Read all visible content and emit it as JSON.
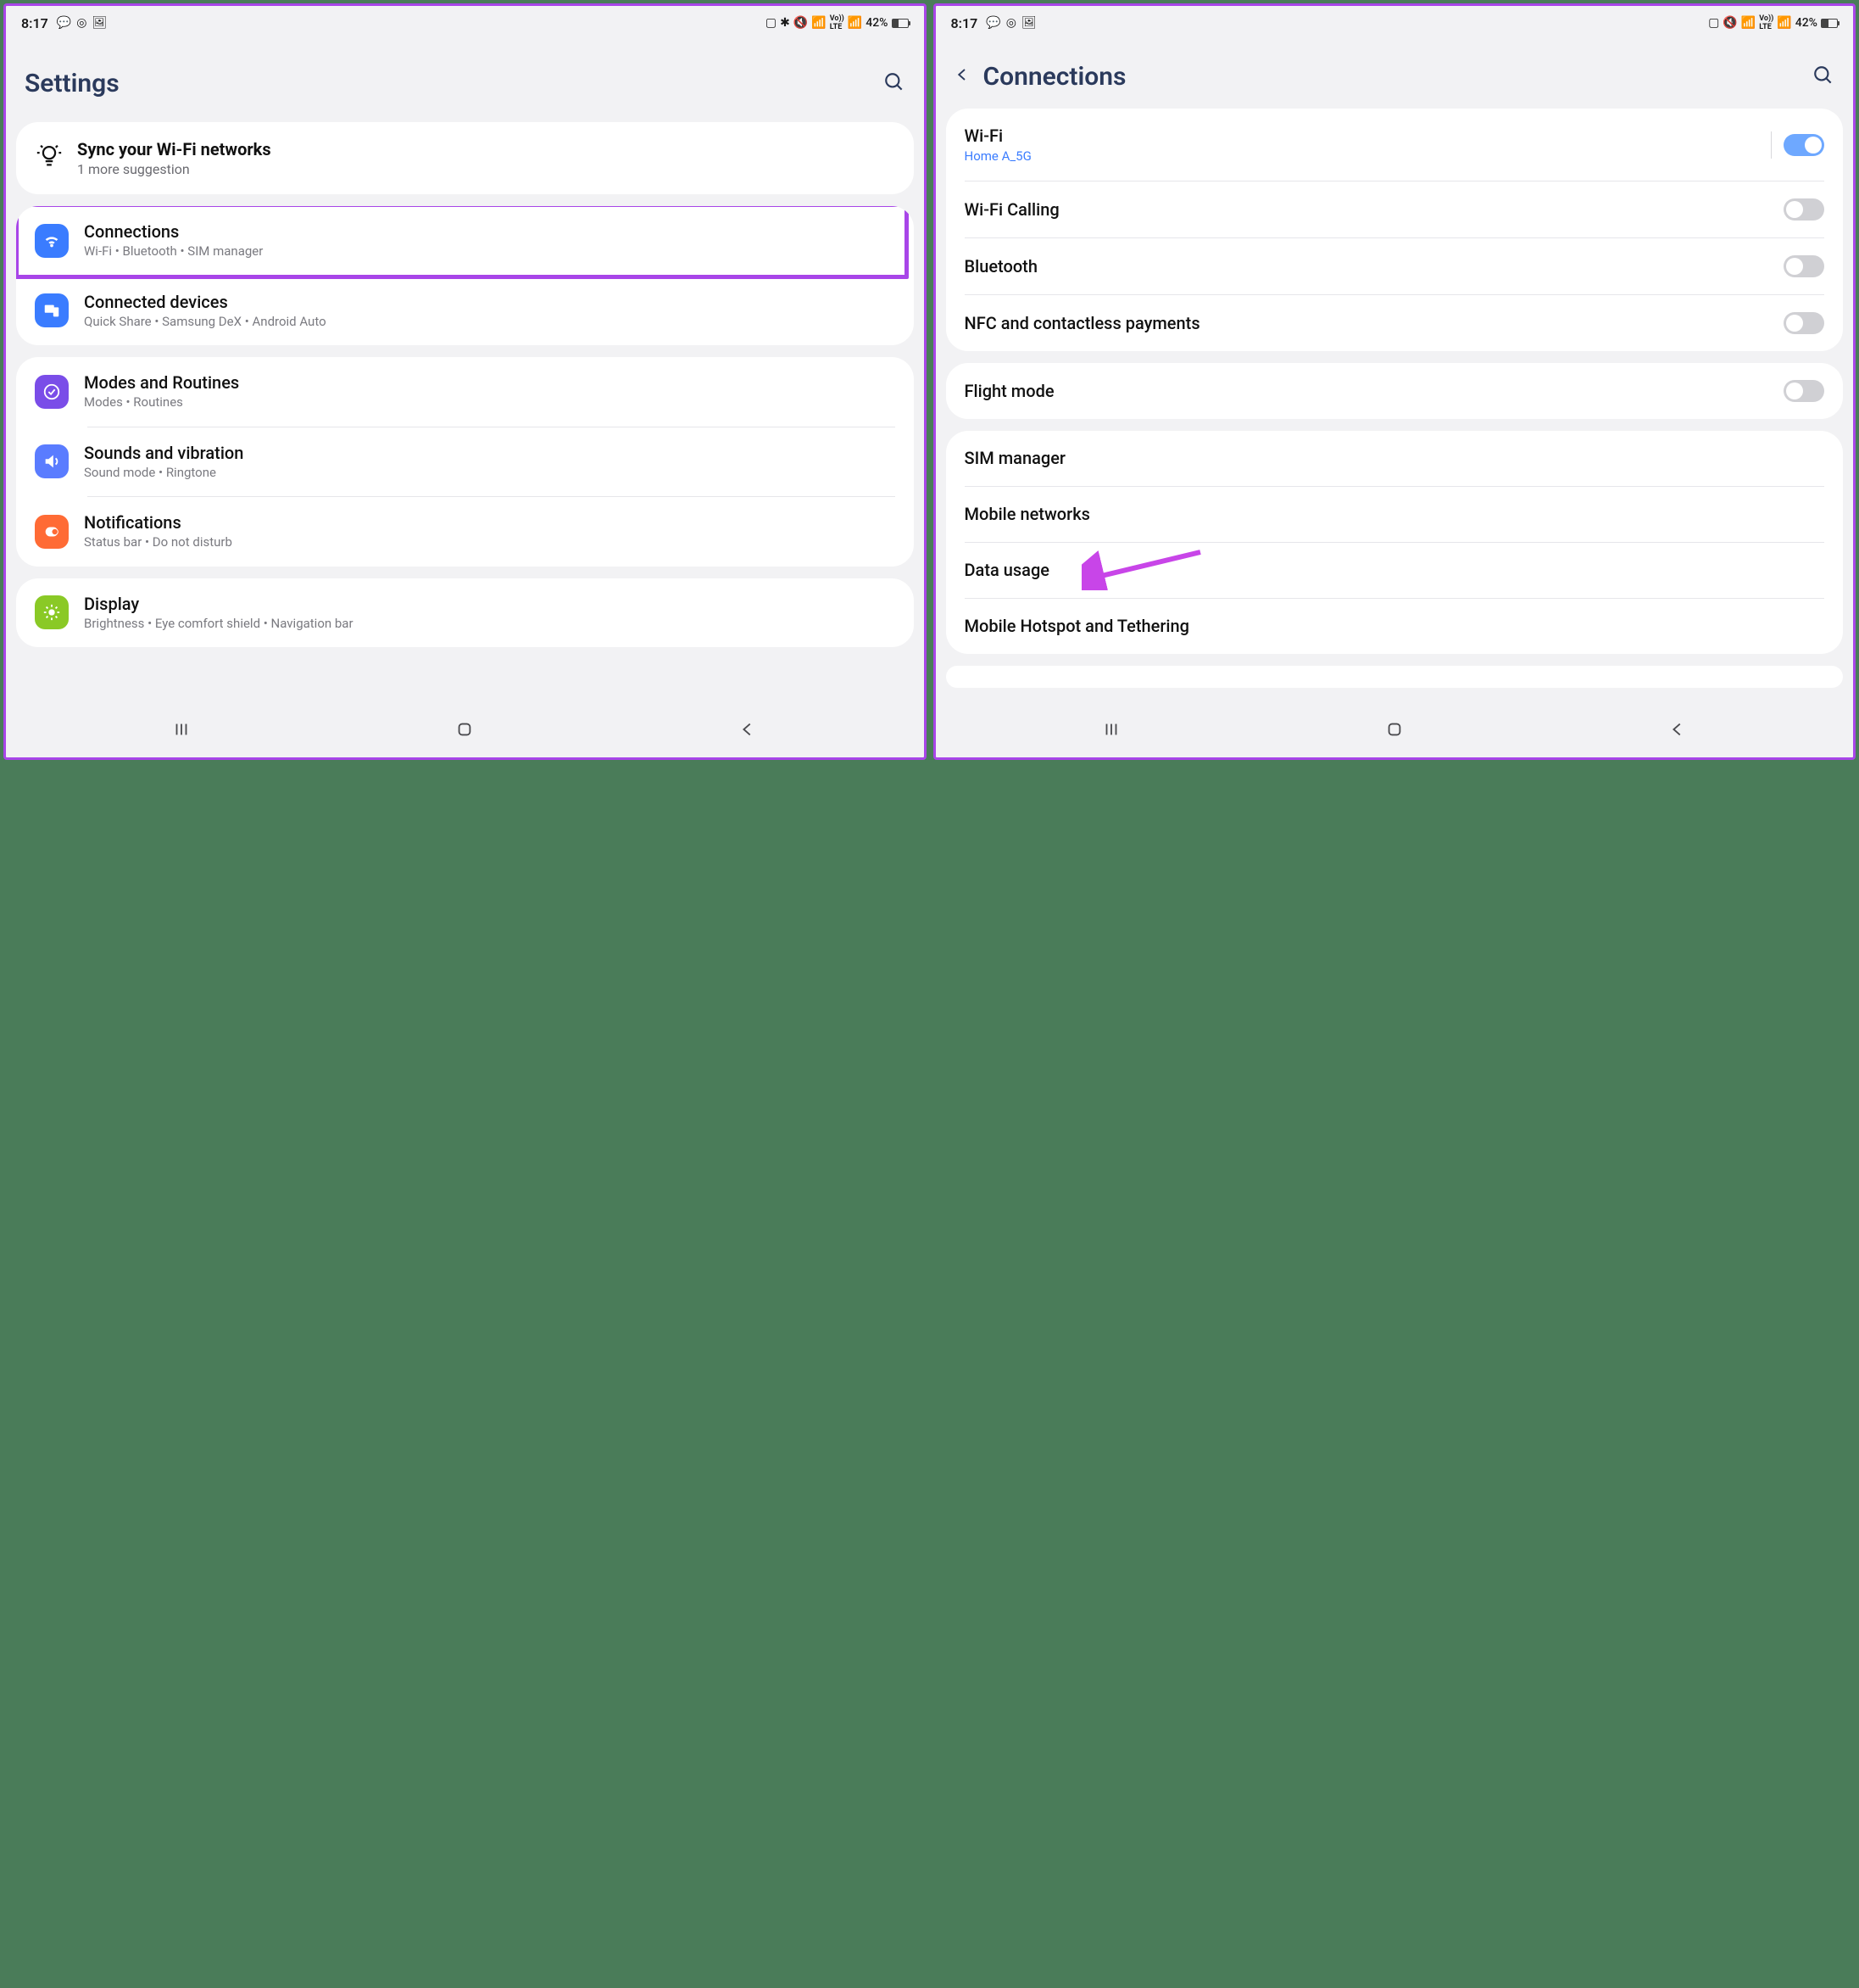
{
  "status": {
    "time": "8:17",
    "battery": "42%",
    "indicators_left": [
      "chat",
      "instagram",
      "image"
    ],
    "indicators_right_a": [
      "battery-saver",
      "bluetooth",
      "mute",
      "wifi",
      "volte",
      "signal"
    ],
    "indicators_right_b": [
      "battery-saver",
      "mute",
      "wifi",
      "volte",
      "signal"
    ]
  },
  "left": {
    "title": "Settings",
    "tip": {
      "title": "Sync your Wi-Fi networks",
      "sub": "1 more suggestion"
    },
    "groups": [
      [
        {
          "icon": "wifi",
          "color": "ic-blue",
          "title": "Connections",
          "sub": "Wi-Fi  •  Bluetooth  •  SIM manager",
          "highlight": true
        },
        {
          "icon": "devices",
          "color": "ic-blue2",
          "title": "Connected devices",
          "sub": "Quick Share  •  Samsung DeX  •  Android Auto"
        }
      ],
      [
        {
          "icon": "modes",
          "color": "ic-purple",
          "title": "Modes and Routines",
          "sub": "Modes  •  Routines"
        },
        {
          "icon": "sound",
          "color": "ic-bluegray",
          "title": "Sounds and vibration",
          "sub": "Sound mode  •  Ringtone"
        },
        {
          "icon": "notif",
          "color": "ic-orange",
          "title": "Notifications",
          "sub": "Status bar  •  Do not disturb"
        }
      ],
      [
        {
          "icon": "display",
          "color": "ic-green",
          "title": "Display",
          "sub": "Brightness  •  Eye comfort shield  •  Navigation bar"
        }
      ]
    ]
  },
  "right": {
    "title": "Connections",
    "groups": [
      [
        {
          "title": "Wi-Fi",
          "sub": "Home A_5G",
          "toggle": true,
          "on": true,
          "sep": true
        },
        {
          "title": "Wi-Fi Calling",
          "toggle": true,
          "on": false
        },
        {
          "title": "Bluetooth",
          "toggle": true,
          "on": false
        },
        {
          "title": "NFC and contactless payments",
          "toggle": true,
          "on": false
        }
      ],
      [
        {
          "title": "Flight mode",
          "toggle": true,
          "on": false
        }
      ],
      [
        {
          "title": "SIM manager"
        },
        {
          "title": "Mobile networks"
        },
        {
          "title": "Data usage",
          "arrow": true
        },
        {
          "title": "Mobile Hotspot and Tethering"
        }
      ]
    ]
  }
}
